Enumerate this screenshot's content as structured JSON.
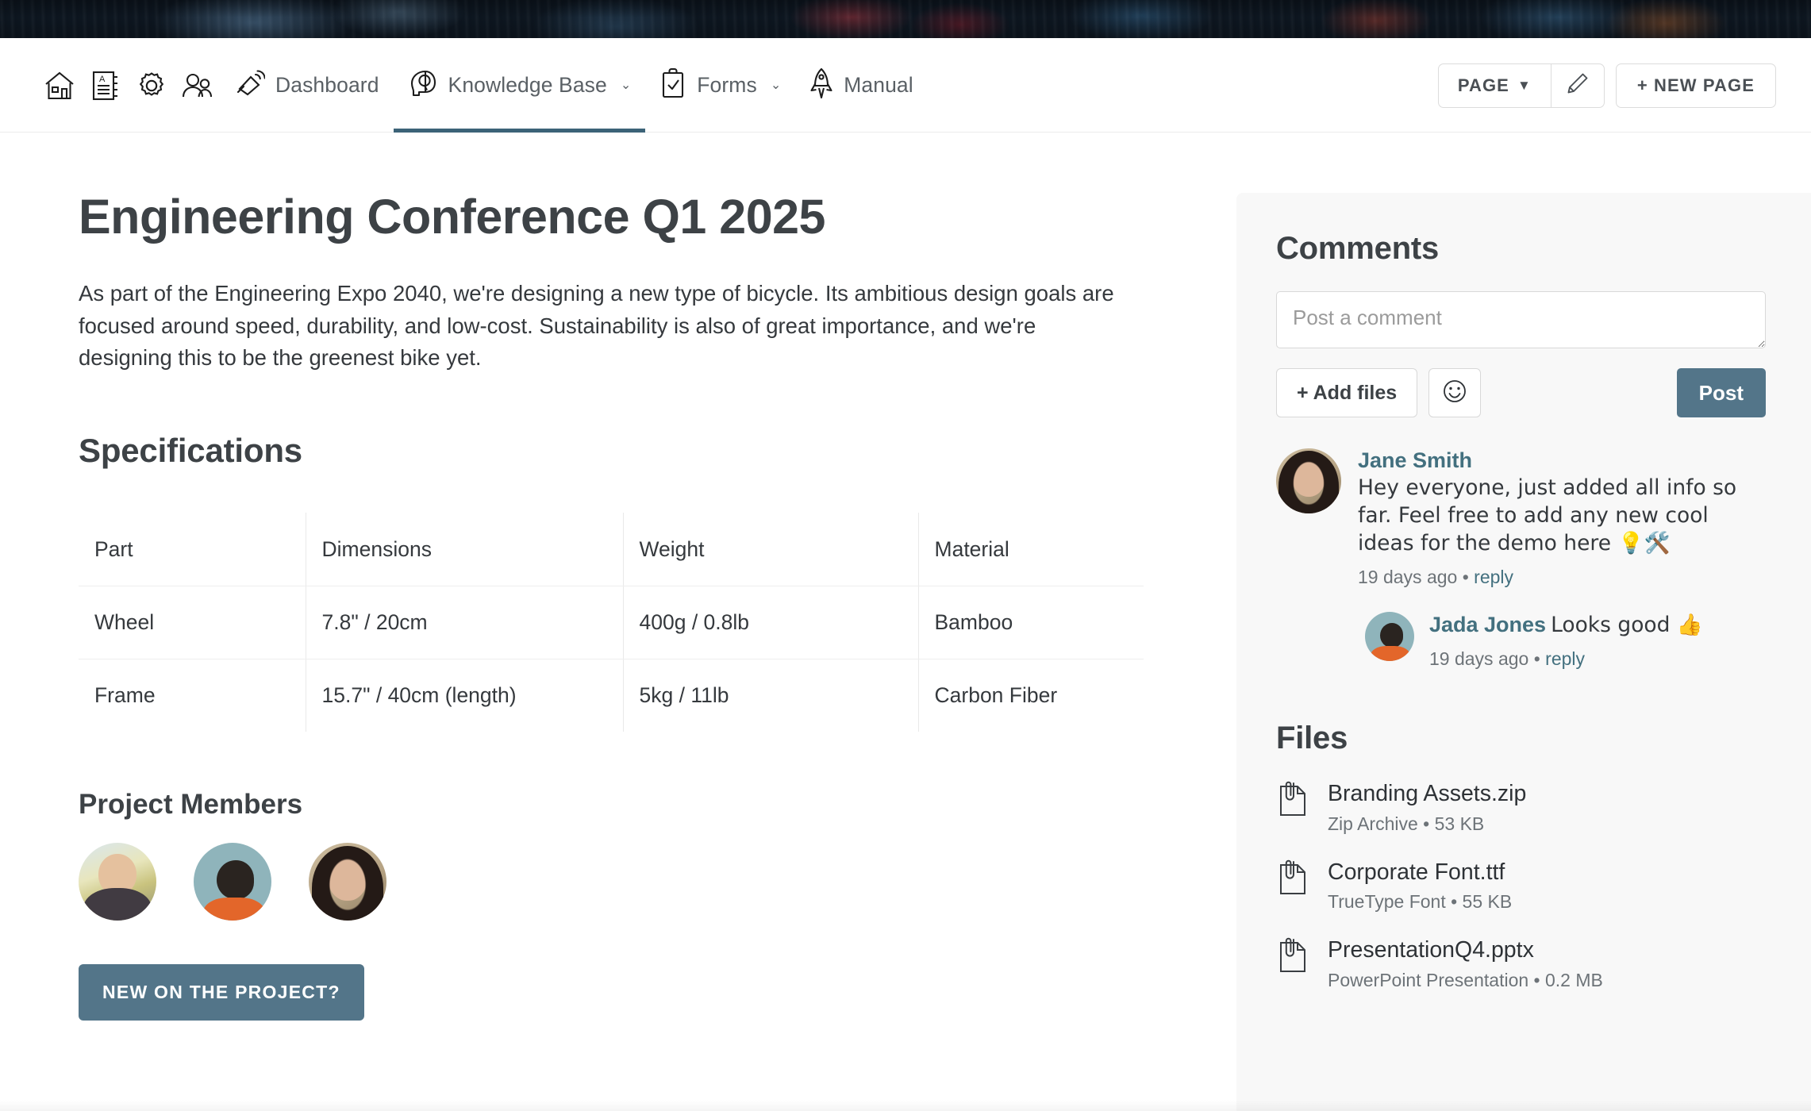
{
  "banner": {
    "alt": "abstract-smoke-banner"
  },
  "navbar": {
    "icons": [
      {
        "name": "home-icon",
        "label": "Home"
      },
      {
        "name": "notebook-icon",
        "label": "Notebook"
      },
      {
        "name": "gear-icon",
        "label": "Settings"
      },
      {
        "name": "users-icon",
        "label": "Users"
      }
    ],
    "items": [
      {
        "label": "Dashboard",
        "icon": "megaphone-icon",
        "caret": "",
        "active": false
      },
      {
        "label": "Knowledge Base",
        "icon": "brain-head-icon",
        "caret": "⌄",
        "active": true
      },
      {
        "label": "Forms",
        "icon": "clipboard-check-icon",
        "caret": "⌄",
        "active": false
      },
      {
        "label": "Manual",
        "icon": "rocket-icon",
        "caret": "",
        "active": false
      }
    ],
    "page_button": "PAGE",
    "page_caret": "▼",
    "edit_icon": "pencil-icon",
    "new_page_button": "+ NEW PAGE",
    "active_underline_color": "#3c6378"
  },
  "main": {
    "title": "Engineering Conference Q1 2025",
    "intro": "As part of the Engineering Expo 2040, we're designing a new type of bicycle. Its ambitious design goals are focused around speed, durability, and low-cost. Sustainability is also of great importance, and we're designing this to be the greenest bike yet.",
    "specs_heading": "Specifications",
    "table": {
      "headers": [
        "Part",
        "Dimensions",
        "Weight",
        "Material"
      ],
      "rows": [
        [
          "Wheel",
          "7.8\" / 20cm",
          "400g / 0.8lb",
          "Bamboo"
        ],
        [
          "Frame",
          "15.7\" / 40cm (length)",
          "5kg / 11lb",
          "Carbon Fiber"
        ]
      ]
    },
    "members_heading": "Project Members",
    "members": [
      {
        "name": "member-avatar-1"
      },
      {
        "name": "member-avatar-2"
      },
      {
        "name": "member-avatar-3"
      }
    ],
    "new_project_button": "NEW ON THE PROJECT?",
    "new_project_button_color": "#537589"
  },
  "sidebar": {
    "comments_heading": "Comments",
    "comment_placeholder": "Post a comment",
    "comment_value": "",
    "add_files_button": "+ Add files",
    "emoji_button_icon": "smiley-face-icon",
    "post_button": "Post",
    "post_button_color": "#537589",
    "comments": [
      {
        "author": "Jane Smith",
        "text": "Hey everyone, just added all info so far. Feel free to add any new cool ideas for the demo here 💡🛠️",
        "time": "19 days ago",
        "separator": "•",
        "reply_link": "reply",
        "reply": {
          "author": "Jada Jones",
          "text": "Looks good 👍",
          "time": "19 days ago",
          "separator": "•",
          "reply_link": "reply"
        }
      }
    ],
    "files_heading": "Files",
    "files": [
      {
        "name": "Branding Assets.zip",
        "meta": "Zip Archive • 53 KB",
        "icon": "paperclip-file-icon"
      },
      {
        "name": "Corporate Font.ttf",
        "meta": "TrueType Font • 55 KB",
        "icon": "paperclip-file-icon"
      },
      {
        "name": "PresentationQ4.pptx",
        "meta": "PowerPoint Presentation • 0.2 MB",
        "icon": "paperclip-file-icon"
      }
    ]
  }
}
